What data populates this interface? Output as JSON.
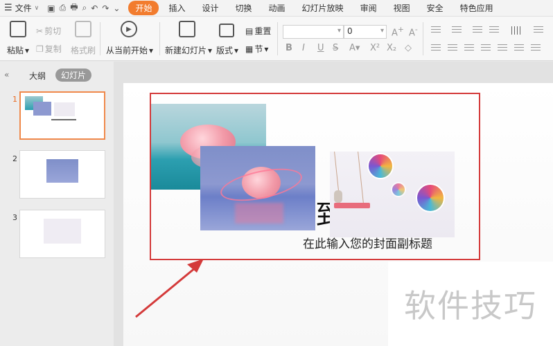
{
  "menubar": {
    "file_label": "文件",
    "tabs": [
      {
        "label": "开始",
        "active": true
      },
      {
        "label": "插入",
        "active": false
      },
      {
        "label": "设计",
        "active": false
      },
      {
        "label": "切换",
        "active": false
      },
      {
        "label": "动画",
        "active": false
      },
      {
        "label": "幻灯片放映",
        "active": false
      },
      {
        "label": "审阅",
        "active": false
      },
      {
        "label": "视图",
        "active": false
      },
      {
        "label": "安全",
        "active": false
      },
      {
        "label": "特色应用",
        "active": false
      }
    ],
    "accent": "#f27c2e"
  },
  "ribbon": {
    "paste_label": "粘贴",
    "cut_label": "剪切",
    "copy_label": "复制",
    "format_painter_label": "格式刷",
    "from_current_label": "从当前开始",
    "new_slide_label": "新建幻灯片",
    "layout_label": "版式",
    "reset_label": "重置",
    "section_label": "节",
    "font_name_value": "",
    "font_size_value": "0"
  },
  "leftpanel": {
    "tab_outline": "大纲",
    "tab_slides": "幻灯片",
    "slides": [
      {
        "num": "1",
        "selected": true
      },
      {
        "num": "2",
        "selected": false
      },
      {
        "num": "3",
        "selected": false
      }
    ]
  },
  "slide": {
    "title_char": "到",
    "subtitle": "在此输入您的封面副标题"
  },
  "watermark": "软件技巧",
  "colors": {
    "selection_border": "#d43a3a",
    "arrow": "#d43a3a"
  }
}
